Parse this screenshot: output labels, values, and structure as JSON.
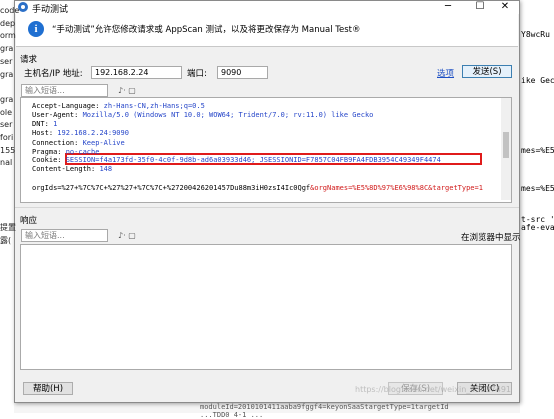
{
  "background": {
    "left_lines": [
      "code",
      "dep",
      "orm",
      "gra",
      "ser",
      "gra",
      "",
      "gra",
      "ole",
      "ser",
      "fori",
      "155",
      "nal",
      "",
      "",
      "",
      "",
      "提置",
      "露("
    ],
    "right_lines": [
      "Y8wcRu",
      "",
      "",
      "",
      "",
      "",
      "ike Gec",
      "",
      "",
      "",
      "",
      "",
      "",
      "",
      "",
      "mes=%E5",
      "",
      "",
      "",
      "",
      "mes=%E5",
      "",
      "",
      "",
      "t-src '",
      "afe-eva"
    ],
    "bottom_lines": [
      "moduleId=2010101411aaba9fggf4=keyonSaaStargetType=1targetId",
      "...TDD0 4-1 ..."
    ]
  },
  "dialog": {
    "title": "手动测试",
    "window_buttons": {
      "minimize": "─",
      "maximize": "☐",
      "close": "✕"
    },
    "banner_text": "“手动测试”允许您修改请求或 AppScan 测试，以及将更改保存为 Manual Test®",
    "request": {
      "section_label": "请求",
      "host_label": "主机名/IP 地址:",
      "host_value": "192.168.2.24",
      "port_label": "端口:",
      "port_value": "9090",
      "options_link": "选项",
      "send_button": "发送(S)",
      "search_placeholder": "输入短语...",
      "search_tools": "♪· ▢",
      "headers": [
        {
          "key": "Accept-Language: ",
          "val": "zh-Hans-CN,zh-Hans;q=0.5",
          "extra": ""
        },
        {
          "key": "User-Agent: ",
          "val": "Mozilla/5.0 (Windows NT 10.0; WOW64; Trident/7.0; rv:11.0) like Gecko",
          "extra": ""
        },
        {
          "key": "DNT: ",
          "val": "1",
          "extra": ""
        },
        {
          "key": "Host: ",
          "val": "192.168.2.24:9090",
          "extra": ""
        },
        {
          "key": "Connection: ",
          "val": "Keep-Alive",
          "extra": ""
        },
        {
          "key": "Pragma: ",
          "val": "no-cache",
          "extra": ""
        },
        {
          "key": "Cookie: ",
          "val": "SESSION=f4a173fd-35f0-4c0f-9d8b-ad6a03933d46; JSESSIONID=F7857C04FB9FA4FDB3954C49349F4474",
          "extra": ""
        },
        {
          "key": "Content-Length: ",
          "val": "148",
          "extra": ""
        },
        {
          "key": "",
          "val": "",
          "extra": ""
        },
        {
          "key": "orgIds=%27+%7C%7C+%27%27+%7C%7C+%27200426201457Du88m3iH0zsI4Ic0Qgf",
          "val": "",
          "extra": "&orgNames=%E5%8D%97%E6%98%8C&targetType=1"
        }
      ]
    },
    "response": {
      "section_label": "响应",
      "search_placeholder": "输入短语...",
      "search_tools": "♪· ▢",
      "browser_label": "在浏览器中显示"
    },
    "footer": {
      "help_button": "帮助(H)",
      "save_button": "保存(S)",
      "close_button": "关闭(C)"
    },
    "watermark": "https://blog.csdn.net/weixin_43537491"
  }
}
